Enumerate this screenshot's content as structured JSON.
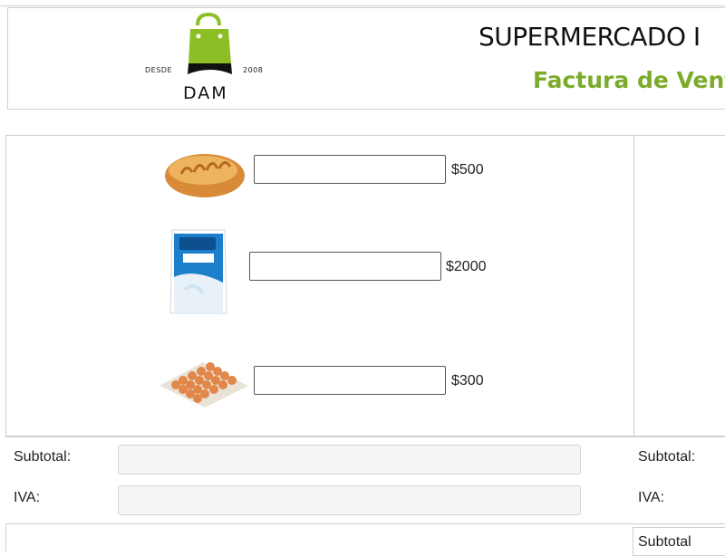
{
  "header": {
    "logo": {
      "left_text": "DESDE",
      "right_text": "2008",
      "brand": "DAM",
      "bag_color": "#8cbf26",
      "icon": "shopping-bag-icon"
    },
    "store_name": "SUPERMERCADO I",
    "invoice_title": "Factura de Venta"
  },
  "products": [
    {
      "name": "bread",
      "icon": "bread-icon",
      "quantity": "",
      "price": "$500"
    },
    {
      "name": "milk",
      "icon": "milk-bag-icon",
      "quantity": "",
      "price": "$2000"
    },
    {
      "name": "eggs",
      "icon": "egg-tray-icon",
      "quantity": "",
      "price": "$300"
    }
  ],
  "totals": {
    "subtotal_label": "Subtotal:",
    "iva_label": "IVA:",
    "subtotal_value": "",
    "iva_value": "",
    "right_subtotal_label": "Subtotal:",
    "right_iva_label": "IVA:"
  },
  "bottom": {
    "partial_label": "Subtotal"
  },
  "colors": {
    "accent_green": "#7cab2b",
    "border": "#cfcfcf",
    "readonly_bg": "#f5f5f5"
  }
}
